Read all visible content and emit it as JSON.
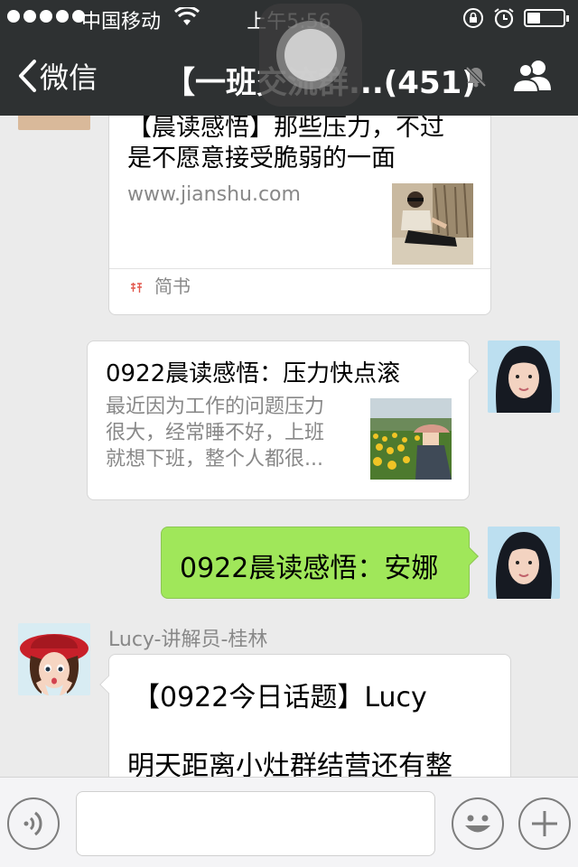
{
  "status_bar": {
    "carrier": "中国移动",
    "time": "上午5:56",
    "battery_level": 0.35,
    "icons": [
      "signal-dots-icon",
      "wifi-icon",
      "rotation-lock-icon",
      "alarm-icon",
      "battery-icon"
    ]
  },
  "nav": {
    "back_label": "微信",
    "title": "【一班交流群...(451)",
    "icons": [
      "chevron-left-icon",
      "mute-bell-icon",
      "group-members-icon"
    ]
  },
  "messages": {
    "link1": {
      "title_lines": [
        "【晨读感悟】那些压力，不过",
        "是不愿意接受脆弱的一面"
      ],
      "url": "www.jianshu.com",
      "source": "简书"
    },
    "link2": {
      "title": "0922晨读感悟：压力快点滚",
      "desc_lines": [
        "最近因为工作的问题压力",
        "很大，经常睡不好，上班",
        "就想下班，整个人都很..."
      ]
    },
    "text1": "0922晨读感悟：安娜",
    "lucy": {
      "sender": "Lucy-讲解员-桂林",
      "line1": "【0922今日话题】Lucy",
      "line2": "明天距离小灶群结营还有整"
    }
  },
  "input": {
    "value": "",
    "icons": [
      "voice-icon",
      "emoji-icon",
      "plus-icon"
    ]
  },
  "colors": {
    "bar_bg": "#2e3132",
    "chat_bg": "#ebebeb",
    "green_bubble": "#a0e75a"
  }
}
